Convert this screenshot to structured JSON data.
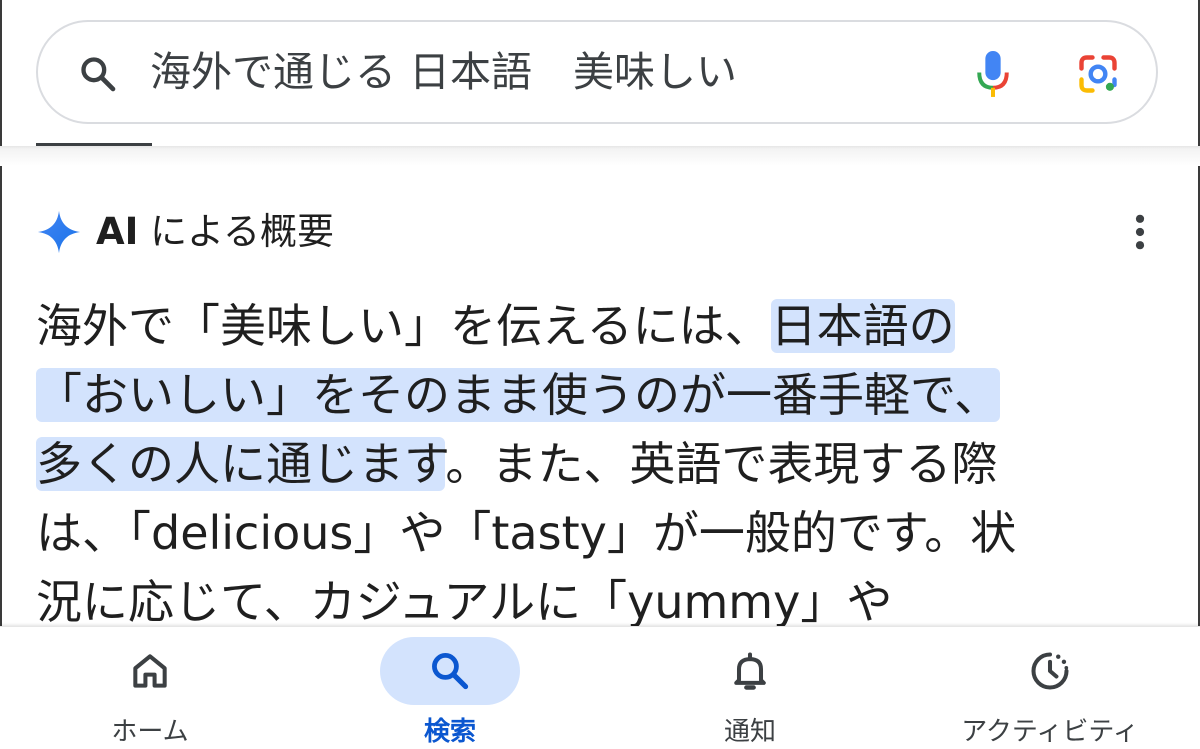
{
  "search": {
    "query": "海外で通じる 日本語　美味しい",
    "search_icon": "search-icon",
    "mic_icon": "mic-icon",
    "lens_icon": "google-lens-icon"
  },
  "ai_overview": {
    "icon": "sparkle-icon",
    "title_prefix": "AI",
    "title_suffix": "による概要",
    "menu_icon": "more-vert-icon",
    "lines": [
      {
        "plain": "海外で「美味しい」を伝えるには、",
        "highlight": "日本語の",
        "rest": ""
      },
      {
        "plain": "",
        "highlight": "「おいしい」をそのまま使うのが一番手軽で、",
        "rest": ""
      },
      {
        "plain": "",
        "highlight": "多くの人に通じます",
        "rest": "。また、英語で表現する際"
      },
      {
        "plain": "は、「delicious」や「tasty」が一般的です。状",
        "highlight": "",
        "rest": ""
      },
      {
        "plain": "況に応じて、カジュアルに「yummy」や",
        "highlight": "",
        "rest": ""
      }
    ],
    "highlight_color": "#d3e3fd"
  },
  "bottom_nav": {
    "items": [
      {
        "label": "ホーム",
        "icon": "home-icon",
        "active": false
      },
      {
        "label": "検索",
        "icon": "search-icon",
        "active": true
      },
      {
        "label": "通知",
        "icon": "bell-icon",
        "active": false
      },
      {
        "label": "アクティビティ",
        "icon": "activity-icon",
        "active": false
      }
    ],
    "active_color": "#0b57d0",
    "pill_color": "#d3e3fd"
  }
}
